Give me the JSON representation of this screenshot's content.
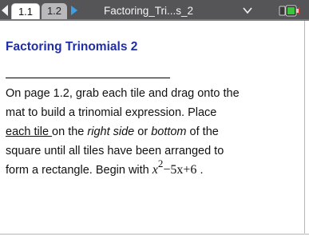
{
  "topbar": {
    "tab1_label": "1.1",
    "tab2_label": "1.2",
    "doc_title": "Factoring_Tri...s_2"
  },
  "content": {
    "heading": "Factoring Trinomials 2",
    "p1": "On page 1.2, grab each tile and drag onto the",
    "p2": "mat to build a trinomial expression. Place",
    "p3_a": "each tile ",
    "p3_b": "on the ",
    "p3_c": "right side",
    "p3_d": " or ",
    "p3_e": "bottom",
    "p3_f": " of the",
    "p4": "square until all tiles have been arranged to",
    "p5_a": "form a rectangle. Begin with ",
    "math_x": "x",
    "math_exp": "2",
    "math_rest": "−5x+6",
    "p5_end": " ."
  },
  "colors": {
    "heading": "#1f2ea8",
    "topbar": "#555558",
    "forward_arrow": "#3aa0e8"
  },
  "icons": {
    "back": "left-arrow-icon",
    "forward": "right-arrow-icon",
    "menu": "chevron-down-icon",
    "battery": "battery-icon"
  }
}
